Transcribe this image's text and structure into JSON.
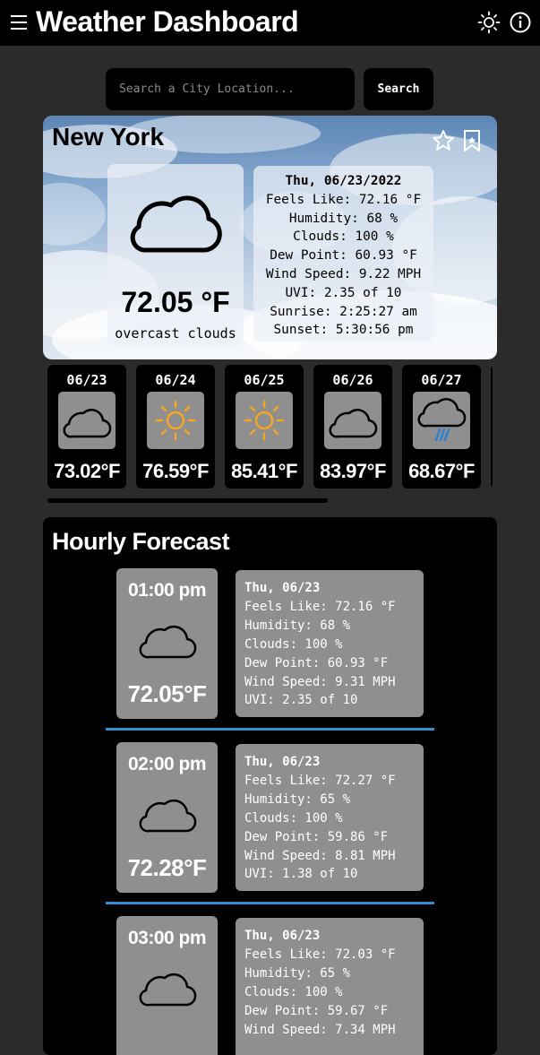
{
  "header": {
    "title": "Weather Dashboard",
    "menu_icon": "hamburger-menu-icon",
    "theme_icon": "sun-icon",
    "info_icon": "info-icon"
  },
  "search": {
    "placeholder": "Search a City Location...",
    "button_label": "Search"
  },
  "current": {
    "city": "New York",
    "temp": "72.05 °F",
    "condition": "overcast clouds",
    "icon": "cloud-icon",
    "favorite_icon": "star-icon",
    "bookmark_icon": "bookmark-icon",
    "date": "Thu, 06/23/2022",
    "details": [
      "Feels Like: 72.16 °F",
      "Humidity: 68 %",
      "Clouds: 100 %",
      "Dew Point: 60.93 °F",
      "Wind Speed: 9.22 MPH",
      "UVI: 2.35 of 10",
      "Sunrise: 2:25:27 am",
      "Sunset: 5:30:56 pm"
    ]
  },
  "daily": [
    {
      "date": "06/23",
      "temp": "73.02°F",
      "icon": "cloud-icon"
    },
    {
      "date": "06/24",
      "temp": "76.59°F",
      "icon": "sun-icon"
    },
    {
      "date": "06/25",
      "temp": "85.41°F",
      "icon": "sun-icon"
    },
    {
      "date": "06/26",
      "temp": "83.97°F",
      "icon": "cloud-icon"
    },
    {
      "date": "06/27",
      "temp": "68.67°F",
      "icon": "rain-cloud-icon"
    }
  ],
  "hourly": {
    "title": "Hourly Forecast",
    "items": [
      {
        "time": "01:00 pm",
        "temp": "72.05°F",
        "icon": "cloud-icon",
        "date": "Thu, 06/23",
        "feels": "Feels Like: 72.16 °F",
        "humidity": "Humidity: 68 %",
        "clouds": "Clouds: 100 %",
        "dew": "Dew Point: 60.93 °F",
        "wind": "Wind Speed: 9.31 MPH",
        "uvi": "UVI: 2.35 of 10"
      },
      {
        "time": "02:00 pm",
        "temp": "72.28°F",
        "icon": "cloud-icon",
        "date": "Thu, 06/23",
        "feels": "Feels Like: 72.27 °F",
        "humidity": "Humidity: 65 %",
        "clouds": "Clouds: 100 %",
        "dew": "Dew Point: 59.86 °F",
        "wind": "Wind Speed: 8.81 MPH",
        "uvi": "UVI: 1.38 of 10"
      },
      {
        "time": "03:00 pm",
        "temp": "",
        "icon": "cloud-icon",
        "date": "Thu, 06/23",
        "feels": "Feels Like: 72.03 °F",
        "humidity": "Humidity: 65 %",
        "clouds": "Clouds: 100 %",
        "dew": "Dew Point: 59.67 °F",
        "wind": "Wind Speed: 7.34 MPH",
        "uvi": ""
      }
    ]
  },
  "colors": {
    "background": "#2b2b2b",
    "panel": "#000000",
    "card_gray": "#8f8f8f",
    "divider_blue": "#2f8fd1",
    "sun_orange": "#f5a623"
  }
}
